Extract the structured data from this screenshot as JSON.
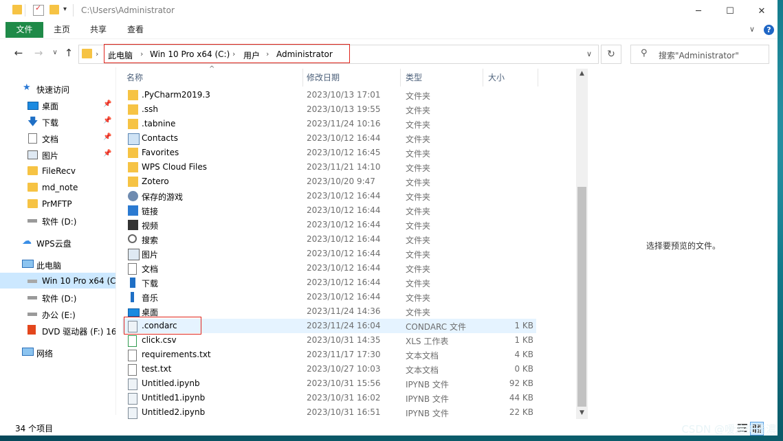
{
  "title_bar": {
    "path": "C:\\Users\\Administrator",
    "minimize": "─",
    "maximize": "☐",
    "close": "✕"
  },
  "ribbon": {
    "tabs": [
      "文件",
      "主页",
      "共享",
      "查看"
    ],
    "expand": "∨",
    "help": "?"
  },
  "nav": {
    "back": "←",
    "forward": "→",
    "history": "∨",
    "up": "↑",
    "breadcrumb": [
      "此电脑",
      "Win 10 Pro x64 (C:)",
      "用户",
      "Administrator"
    ],
    "addr_dropdown": "∨",
    "refresh": "↻",
    "search_placeholder": "搜索\"Administrator\""
  },
  "sidebar": [
    {
      "label": "快速访问",
      "icon": "star-icon",
      "pinned": false
    },
    {
      "label": "桌面",
      "icon": "desktop-icon",
      "pinned": true
    },
    {
      "label": "下载",
      "icon": "download-icon",
      "pinned": true
    },
    {
      "label": "文档",
      "icon": "document-icon",
      "pinned": true
    },
    {
      "label": "图片",
      "icon": "pictures-icon",
      "pinned": true
    },
    {
      "label": "FileRecv",
      "icon": "folder-icon",
      "pinned": false
    },
    {
      "label": "md_note",
      "icon": "folder-icon",
      "pinned": false
    },
    {
      "label": "PrMFTP",
      "icon": "folder-icon",
      "pinned": false
    },
    {
      "label": "软件 (D:)",
      "icon": "drive-icon",
      "pinned": false
    },
    {
      "label": "WPS云盘",
      "icon": "cloud-icon",
      "pinned": false
    },
    {
      "label": "此电脑",
      "icon": "computer-icon",
      "pinned": false
    },
    {
      "label": "Win 10 Pro x64 (C",
      "icon": "system-drive-icon",
      "pinned": false
    },
    {
      "label": "软件 (D:)",
      "icon": "drive-icon",
      "pinned": false
    },
    {
      "label": "办公 (E:)",
      "icon": "drive-icon",
      "pinned": false
    },
    {
      "label": "DVD 驱动器 (F:) 16",
      "icon": "office-dvd-icon",
      "pinned": false
    },
    {
      "label": "网络",
      "icon": "network-icon",
      "pinned": false
    }
  ],
  "columns": [
    "名称",
    "修改日期",
    "类型",
    "大小"
  ],
  "sort_indicator": "^",
  "files": [
    {
      "name": ".PyCharm2019.3",
      "date": "2023/10/13 17:01",
      "type": "文件夹",
      "size": "",
      "icon": "folder-icon"
    },
    {
      "name": ".ssh",
      "date": "2023/10/13 19:55",
      "type": "文件夹",
      "size": "",
      "icon": "folder-icon"
    },
    {
      "name": ".tabnine",
      "date": "2023/11/24 10:16",
      "type": "文件夹",
      "size": "",
      "icon": "folder-icon"
    },
    {
      "name": "Contacts",
      "date": "2023/10/12 16:44",
      "type": "文件夹",
      "size": "",
      "icon": "contacts-icon"
    },
    {
      "name": "Favorites",
      "date": "2023/10/12 16:45",
      "type": "文件夹",
      "size": "",
      "icon": "folder-icon"
    },
    {
      "name": "WPS Cloud Files",
      "date": "2023/11/21 14:10",
      "type": "文件夹",
      "size": "",
      "icon": "folder-icon"
    },
    {
      "name": "Zotero",
      "date": "2023/10/20 9:47",
      "type": "文件夹",
      "size": "",
      "icon": "folder-icon"
    },
    {
      "name": "保存的游戏",
      "date": "2023/10/12 16:44",
      "type": "文件夹",
      "size": "",
      "icon": "saved-games-icon"
    },
    {
      "name": "链接",
      "date": "2023/10/12 16:44",
      "type": "文件夹",
      "size": "",
      "icon": "links-icon"
    },
    {
      "name": "视频",
      "date": "2023/10/12 16:44",
      "type": "文件夹",
      "size": "",
      "icon": "videos-icon"
    },
    {
      "name": "搜索",
      "date": "2023/10/12 16:44",
      "type": "文件夹",
      "size": "",
      "icon": "search-icon"
    },
    {
      "name": "图片",
      "date": "2023/10/12 16:44",
      "type": "文件夹",
      "size": "",
      "icon": "pictures-icon"
    },
    {
      "name": "文档",
      "date": "2023/10/12 16:44",
      "type": "文件夹",
      "size": "",
      "icon": "document-icon"
    },
    {
      "name": "下载",
      "date": "2023/10/12 16:44",
      "type": "文件夹",
      "size": "",
      "icon": "download-icon"
    },
    {
      "name": "音乐",
      "date": "2023/10/12 16:44",
      "type": "文件夹",
      "size": "",
      "icon": "music-icon"
    },
    {
      "name": "桌面",
      "date": "2023/11/24 14:36",
      "type": "文件夹",
      "size": "",
      "icon": "desktop-icon"
    },
    {
      "name": ".condarc",
      "date": "2023/11/24 16:04",
      "type": "CONDARC 文件",
      "size": "1 KB",
      "icon": "file-icon"
    },
    {
      "name": "click.csv",
      "date": "2023/10/31 14:35",
      "type": "XLS 工作表",
      "size": "1 KB",
      "icon": "spreadsheet-icon"
    },
    {
      "name": "requirements.txt",
      "date": "2023/11/17 17:30",
      "type": "文本文档",
      "size": "4 KB",
      "icon": "text-file-icon"
    },
    {
      "name": "test.txt",
      "date": "2023/10/27 10:03",
      "type": "文本文档",
      "size": "0 KB",
      "icon": "text-file-icon"
    },
    {
      "name": "Untitled.ipynb",
      "date": "2023/10/31 15:56",
      "type": "IPYNB 文件",
      "size": "92 KB",
      "icon": "file-icon"
    },
    {
      "name": "Untitled1.ipynb",
      "date": "2023/10/31 16:02",
      "type": "IPYNB 文件",
      "size": "44 KB",
      "icon": "file-icon"
    },
    {
      "name": "Untitled2.ipynb",
      "date": "2023/10/31 16:51",
      "type": "IPYNB 文件",
      "size": "22 KB",
      "icon": "file-icon"
    }
  ],
  "selected_file": ".condarc",
  "preview_text": "选择要预览的文件。",
  "status": "34 个项目",
  "watermark": "CSDN @嗳滬倁酒濃",
  "colors": {
    "accent_file_tab": "#1f8a48",
    "highlight_box": "#e0241b",
    "selection": "#cce8ff",
    "row_hover": "#e5f3ff"
  }
}
